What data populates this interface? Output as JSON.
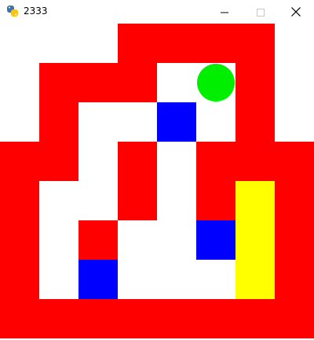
{
  "window": {
    "title": "2333",
    "icon": "python-icon",
    "controls": [
      "minimize-icon",
      "maximize-icon",
      "close-icon"
    ]
  },
  "colors": {
    "wall": "#ff0000",
    "floor": "#ffffff",
    "box": "#0000ff",
    "target": "#ffff00",
    "player": "#00ee00"
  },
  "game": {
    "grid_cols": 8,
    "grid_rows": 8,
    "walls": [
      [
        3,
        0
      ],
      [
        4,
        0
      ],
      [
        5,
        0
      ],
      [
        6,
        0
      ],
      [
        1,
        1
      ],
      [
        2,
        1
      ],
      [
        3,
        1
      ],
      [
        6,
        1
      ],
      [
        1,
        2
      ],
      [
        6,
        2
      ],
      [
        0,
        3
      ],
      [
        1,
        3
      ],
      [
        3,
        3
      ],
      [
        5,
        3
      ],
      [
        6,
        3
      ],
      [
        7,
        3
      ],
      [
        0,
        4
      ],
      [
        3,
        4
      ],
      [
        5,
        4
      ],
      [
        7,
        4
      ],
      [
        0,
        5
      ],
      [
        2,
        5
      ],
      [
        7,
        5
      ],
      [
        0,
        6
      ],
      [
        7,
        6
      ],
      [
        0,
        7
      ],
      [
        1,
        7
      ],
      [
        2,
        7
      ],
      [
        3,
        7
      ],
      [
        4,
        7
      ],
      [
        5,
        7
      ],
      [
        6,
        7
      ],
      [
        7,
        7
      ]
    ],
    "floors": [
      [
        4,
        1
      ],
      [
        5,
        1
      ],
      [
        2,
        2
      ],
      [
        3,
        2
      ],
      [
        4,
        2
      ],
      [
        5,
        2
      ],
      [
        2,
        3
      ],
      [
        4,
        3
      ],
      [
        1,
        4
      ],
      [
        2,
        4
      ],
      [
        4,
        4
      ],
      [
        6,
        4
      ],
      [
        1,
        5
      ],
      [
        3,
        5
      ],
      [
        4,
        5
      ],
      [
        5,
        5
      ],
      [
        6,
        5
      ],
      [
        1,
        6
      ],
      [
        2,
        6
      ],
      [
        3,
        6
      ],
      [
        4,
        6
      ],
      [
        5,
        6
      ],
      [
        6,
        6
      ]
    ],
    "boxes": [
      [
        4,
        2
      ],
      [
        5,
        5
      ],
      [
        2,
        6
      ]
    ],
    "targets": [
      [
        6,
        4
      ],
      [
        6,
        5
      ],
      [
        6,
        6
      ]
    ],
    "player": [
      5,
      1
    ]
  }
}
